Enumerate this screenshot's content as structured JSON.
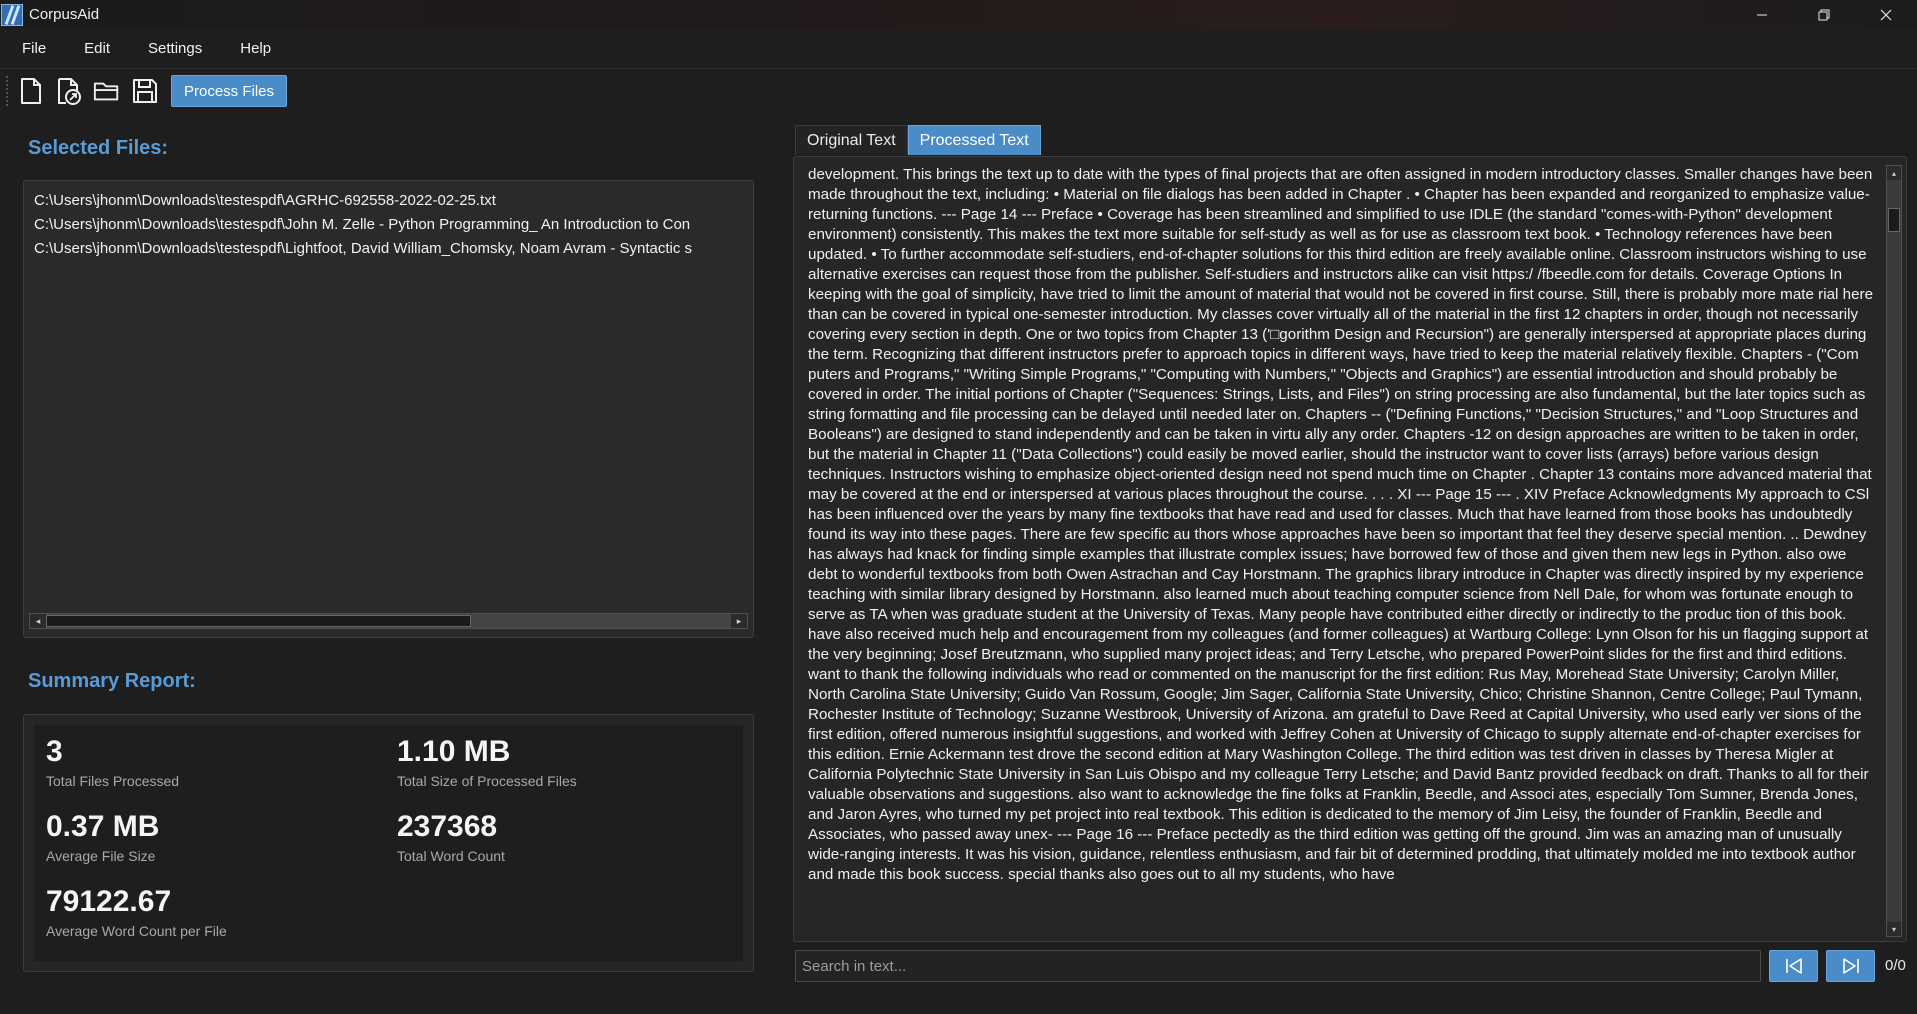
{
  "window": {
    "title": "CorpusAid",
    "controls": [
      "minimize-icon",
      "restore-icon",
      "close-icon"
    ]
  },
  "menu": {
    "items": [
      "File",
      "Edit",
      "Settings",
      "Help"
    ]
  },
  "toolbar": {
    "icons": [
      "new-file-icon",
      "open-file-link-icon",
      "open-folder-icon",
      "save-icon"
    ],
    "process_label": "Process Files"
  },
  "selected_files": {
    "title": "Selected Files:",
    "items": [
      "C:\\Users\\jhonm\\Downloads\\testespdf\\AGRHC-692558-2022-02-25.txt",
      "C:\\Users\\jhonm\\Downloads\\testespdf\\John M. Zelle - Python Programming_ An Introduction to Con",
      "C:\\Users\\jhonm\\Downloads\\testespdf\\Lightfoot, David William_Chomsky, Noam Avram - Syntactic s"
    ]
  },
  "summary": {
    "title": "Summary Report:",
    "stats": [
      {
        "value": "3",
        "label": "Total Files Processed"
      },
      {
        "value": "1.10 MB",
        "label": "Total Size of Processed Files"
      },
      {
        "value": "0.37 MB",
        "label": "Average File Size"
      },
      {
        "value": "237368",
        "label": "Total Word Count"
      },
      {
        "value": "79122.67",
        "label": "Average Word Count per File"
      }
    ]
  },
  "tabs": {
    "original": "Original Text",
    "processed": "Processed Text"
  },
  "processed_text": "development. This brings the text up to date with the types of final projects that are often assigned in modern introductory classes. Smaller changes have been made throughout the text, including: • Material on file dialogs has been added in Chapter . • Chapter has been expanded and reorganized to emphasize value-returning functions. --- Page 14 --- Preface • Coverage has been streamlined and simplified to use IDLE (the standard \"comes-with-Python\" development environment) consistently. This makes the text more suitable for self-study as well as for use as classroom text book. • Technology references have been updated. • To further accommodate self-studiers, end-of-chapter solutions for this third edition are freely available online. Classroom instructors wishing to use alternative exercises can request those from the publisher. Self-studiers and instructors alike can visit https:/ /fbeedle.com for details. Coverage Options In keeping with the goal of simplicity, have tried to limit the amount of material that would not be covered in first course. Still, there is probably more mate rial here than can be covered in typical one-semester introduction. My classes cover virtually all of the material in the first 12 chapters in order, though not necessarily covering every section in depth. One or two topics from Chapter 13 ('□gorithm Design and Recursion\") are generally interspersed at appropriate places during the term. Recognizing that different instructors prefer to approach topics in different ways, have tried to keep the material relatively flexible. Chapters - (\"Com puters and Programs,\" \"Writing Simple Programs,\" \"Computing with Numbers,\" \"Objects and Graphics\") are essential introduction and should probably be covered in order. The initial portions of Chapter (\"Sequences: Strings, Lists, and Files\") on string processing are also fundamental, but the later topics such as string formatting and file processing can be delayed until needed later on. Chapters -- (\"Defining Functions,\" \"Decision Structures,\" and \"Loop Structures and Booleans\") are designed to stand independently and can be taken in virtu ally any order. Chapters -12 on design approaches are written to be taken in order, but the material in Chapter 11 (\"Data Collections\") could easily be moved earlier, should the instructor want to cover lists (arrays) before various design techniques. Instructors wishing to emphasize object-oriented design need not spend much time on Chapter . Chapter 13 contains more advanced material that may be covered at the end or interspersed at various places throughout the course. . . . XI --- Page 15 --- . XIV Preface Acknowledgments My approach to CSl has been influenced over the years by many fine textbooks that have read and used for classes. Much that have learned from those books has undoubtedly found its way into these pages. There are few specific au thors whose approaches have been so important that feel they deserve special mention. .. Dewdney has always had knack for finding simple examples that illustrate complex issues; have borrowed few of those and given them new legs in Python. also owe debt to wonderful textbooks from both Owen Astrachan and Cay Horstmann. The graphics library introduce in Chapter was directly inspired by my experience teaching with similar library designed by Horstmann. also learned much about teaching computer science from Nell Dale, for whom was fortunate enough to serve as TA when was graduate student at the University of Texas. Many people have contributed either directly or indirectly to the produc tion of this book. have also received much help and encouragement from my colleagues (and former colleagues) at Wartburg College: Lynn Olson for his un flagging support at the very beginning; Josef Breutzmann, who supplied many project ideas; and Terry Letsche, who prepared PowerPoint slides for the first and third editions. want to thank the following individuals who read or commented on the manuscript for the first edition: Rus May, Morehead State University; Carolyn Miller, North Carolina State University; Guido Van Rossum, Google; Jim Sager, California State University, Chico; Christine Shannon, Centre College; Paul Tymann, Rochester Institute of Technology; Suzanne Westbrook, University of Arizona. am grateful to Dave Reed at Capital University, who used early ver sions of the first edition, offered numerous insightful suggestions, and worked with Jeffrey Cohen at University of Chicago to supply alternate end-of-chapter exercises for this edition. Ernie Ackermann test drove the second edition at Mary Washington College. The third edition was test driven in classes by Theresa Migler at California Polytechnic State University in San Luis Obispo and my colleague Terry Letsche; and David Bantz provided feedback on draft. Thanks to all for their valuable observations and suggestions. also want to acknowledge the fine folks at Franklin, Beedle, and Associ ates, especially Tom Sumner, Brenda Jones, and Jaron Ayres, who turned my pet project into real textbook. This edition is dedicated to the memory of Jim Leisy, the founder of Franklin, Beedle and Associates, who passed away unex- --- Page 16 --- Preface pectedly as the third edition was getting off the ground. Jim was an amazing man of unusually wide-ranging interests. It was his vision, guidance, relentless enthusiasm, and fair bit of determined prodding, that ultimately molded me into textbook author and made this book success. special thanks also goes out to all my students, who have",
  "search": {
    "placeholder": "Search in text...",
    "value": "",
    "match_count": "0/0"
  },
  "colors": {
    "accent": "#4a8cc7",
    "section_title": "#5b9bd5",
    "background": "#1e1e1e"
  }
}
